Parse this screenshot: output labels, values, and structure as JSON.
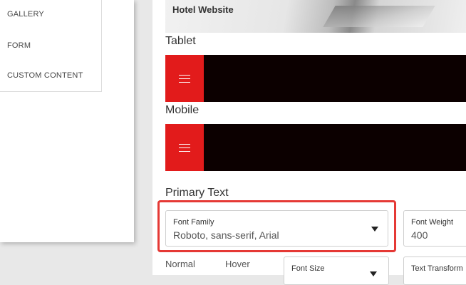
{
  "sidebar": {
    "items": [
      {
        "label": "GALLERY"
      },
      {
        "label": "FORM"
      },
      {
        "label": "CUSTOM CONTENT"
      }
    ]
  },
  "preview": {
    "hero_title": "Hotel Website",
    "tablet_label": "Tablet",
    "mobile_label": "Mobile",
    "nav_color": "#0c0000",
    "accent_color": "#e21b1b"
  },
  "primary_text": {
    "title": "Primary Text",
    "font_family": {
      "label": "Font Family",
      "value": "Roboto, sans-serif, Arial"
    },
    "font_weight": {
      "label": "Font Weight",
      "value": "400"
    },
    "state_tabs": [
      "Normal",
      "Hover"
    ],
    "font_size": {
      "label": "Font Size"
    },
    "text_transform": {
      "label": "Text Transform"
    }
  },
  "icons": [
    "hamburger-menu-icon",
    "chevron-down-icon"
  ],
  "highlight_color": "#e53935"
}
